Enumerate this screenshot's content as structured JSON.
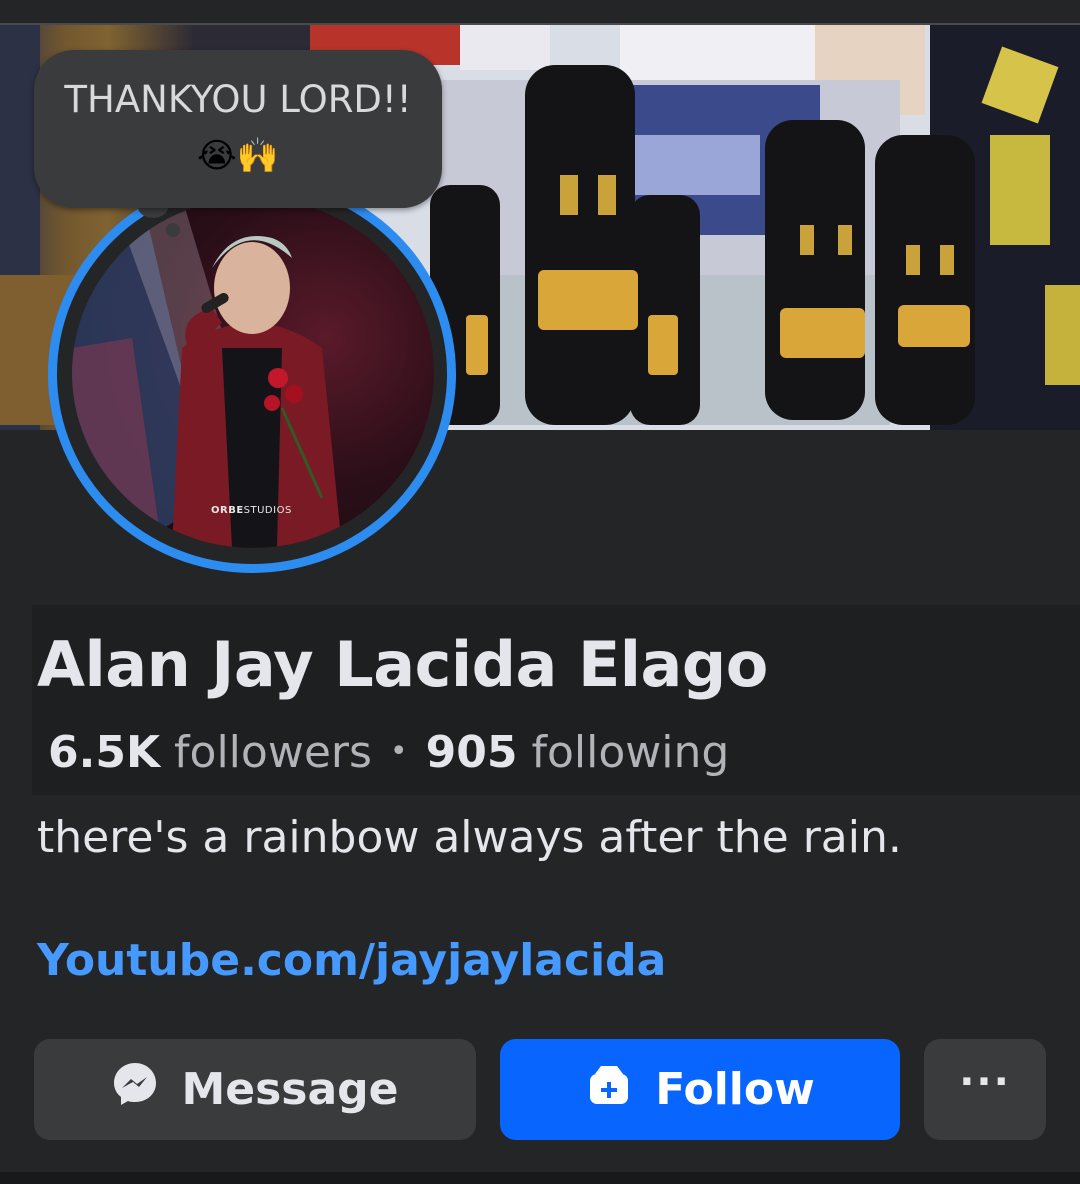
{
  "note": {
    "text": "THANKYOU LORD!!",
    "emojis": "😭🙌"
  },
  "profile": {
    "name": "Alan Jay Lacida Elago",
    "followers_count": "6.5K",
    "followers_label": "followers",
    "following_count": "905",
    "following_label": "following",
    "bio": "there's a rainbow always after the rain.",
    "link": "Youtube.com/jayjaylacida",
    "photo_watermark_bold": "ORBE",
    "photo_watermark_rest": "STUDIOS"
  },
  "actions": {
    "message_label": "Message",
    "follow_label": "Follow",
    "more_label": "···"
  },
  "icons": {
    "message": "messenger-icon",
    "follow": "follow-icon",
    "more": "more-icon"
  },
  "colors": {
    "background": "#242526",
    "primary_button": "#0866ff",
    "secondary_button": "#3a3b3c",
    "link": "#4599ff",
    "avatar_ring": "#2d8cf0"
  }
}
